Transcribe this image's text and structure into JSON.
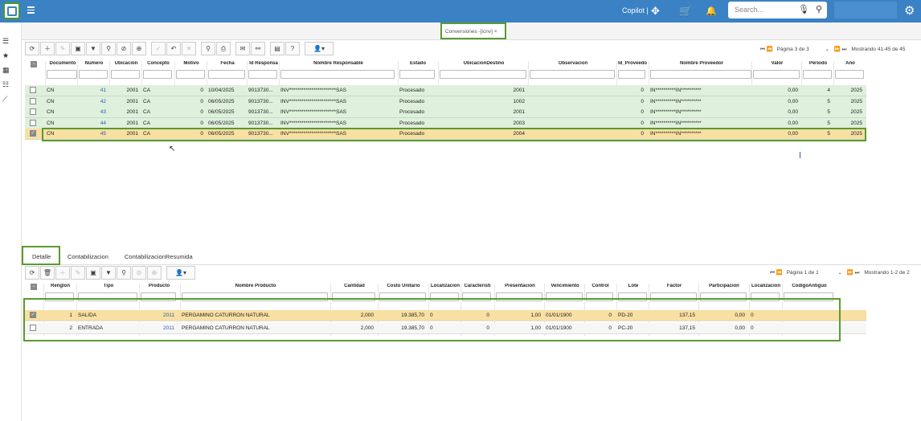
{
  "topbar": {
    "copilot": "Copilot |",
    "search_placeholder": "Search...",
    "colors": {
      "bar": "#3a82c4",
      "selected": "#f8dfa2",
      "green": "#dff0dc"
    }
  },
  "tab": {
    "title": "Conversiones -[icnv]",
    "close": "×"
  },
  "pager_top": {
    "icons": "⏮ ⏪",
    "page": "Página 3 de 3",
    "showing": "Mostrando 41-45 de 45"
  },
  "grid1": {
    "headers": [
      "Documento",
      "Numero",
      "Ubicación",
      "Concepto",
      "Motivo",
      "Fecha",
      "Id Responsa",
      "Nombre Responsable",
      "Estado",
      "UbicacionDestino",
      "Observacion",
      "Id_Proveedo",
      "Nombre Proveedor",
      "Valor",
      "Periodo",
      "Año"
    ],
    "rows": [
      {
        "doc": "CN",
        "num": "41",
        "ubi": "2001",
        "con": "CA",
        "mot": "0",
        "fecha": "10/04/2025",
        "idr": "9013730...",
        "nombre": "INV***********************SAS",
        "estado": "Procesado",
        "dest": "2001",
        "obs": "",
        "idp": "0",
        "prov": "IN**********IN**********",
        "valor": "0,00",
        "per": "4",
        "anio": "2025",
        "checked": false
      },
      {
        "doc": "CN",
        "num": "42",
        "ubi": "2001",
        "con": "CA",
        "mot": "0",
        "fecha": "06/05/2025",
        "idr": "9013730...",
        "nombre": "INV***********************SAS",
        "estado": "Procesado",
        "dest": "1002",
        "obs": "",
        "idp": "0",
        "prov": "IN**********IN**********",
        "valor": "0,00",
        "per": "5",
        "anio": "2025",
        "checked": false
      },
      {
        "doc": "CN",
        "num": "43",
        "ubi": "2001",
        "con": "CA",
        "mot": "0",
        "fecha": "06/05/2025",
        "idr": "9013730...",
        "nombre": "INV***********************SAS",
        "estado": "Procesado",
        "dest": "2001",
        "obs": "",
        "idp": "0",
        "prov": "IN**********IN**********",
        "valor": "0,00",
        "per": "5",
        "anio": "2025",
        "checked": false
      },
      {
        "doc": "CN",
        "num": "44",
        "ubi": "2001",
        "con": "CA",
        "mot": "0",
        "fecha": "06/05/2025",
        "idr": "9013730...",
        "nombre": "INV***********************SAS",
        "estado": "Procesado",
        "dest": "2003",
        "obs": "",
        "idp": "0",
        "prov": "IN**********IN**********",
        "valor": "0,00",
        "per": "5",
        "anio": "2025",
        "checked": false
      },
      {
        "doc": "CN",
        "num": "45",
        "ubi": "2001",
        "con": "CA",
        "mot": "0",
        "fecha": "06/05/2025",
        "idr": "9013730...",
        "nombre": "INV***********************SAS",
        "estado": "Procesado",
        "dest": "2004",
        "obs": "",
        "idp": "0",
        "prov": "IN**********IN**********",
        "valor": "0,00",
        "per": "5",
        "anio": "2025",
        "checked": true
      }
    ]
  },
  "subtabs": [
    "Detalle",
    "Contabilizacion",
    "ContabilizacionResumida"
  ],
  "pager_bottom": {
    "icons": "⏮ ⏪",
    "page": "Página 1 de 1",
    "showing": "Mostrando 1-2 de 2"
  },
  "grid2": {
    "headers": [
      "Renglon",
      "Tipo",
      "Producto",
      "Nombre Producto",
      "Cantidad",
      "Costo Unitario",
      "Localizacion",
      "Caracteristi",
      "Presentacion",
      "Vencimiento",
      "Control",
      "Lote",
      "Factor",
      "Participacion",
      "Localizacion",
      "CodigoAntiguo"
    ],
    "rows": [
      {
        "ren": "1",
        "tipo": "SALIDA",
        "prod": "2011",
        "nombre": "PERGAMINO CATURRON NATURAL",
        "cant": "2,000",
        "costo": "19.385,70",
        "loc": "0",
        "car": "0",
        "pres": "1,00",
        "venc": "01/01/1900",
        "ctrl": "0",
        "lote": "PD-20",
        "factor": "137,15",
        "part": "0,00",
        "loc2": "0",
        "checked": true
      },
      {
        "ren": "2",
        "tipo": "ENTRADA",
        "prod": "2011",
        "nombre": "PERGAMINO CATURRON NATURAL",
        "cant": "2,000",
        "costo": "19.385,70",
        "loc": "0",
        "car": "0",
        "pres": "1,00",
        "venc": "01/01/1900",
        "ctrl": "0",
        "lote": "PC-20",
        "factor": "137,15",
        "part": "0,00",
        "loc2": "0",
        "checked": false
      }
    ]
  }
}
